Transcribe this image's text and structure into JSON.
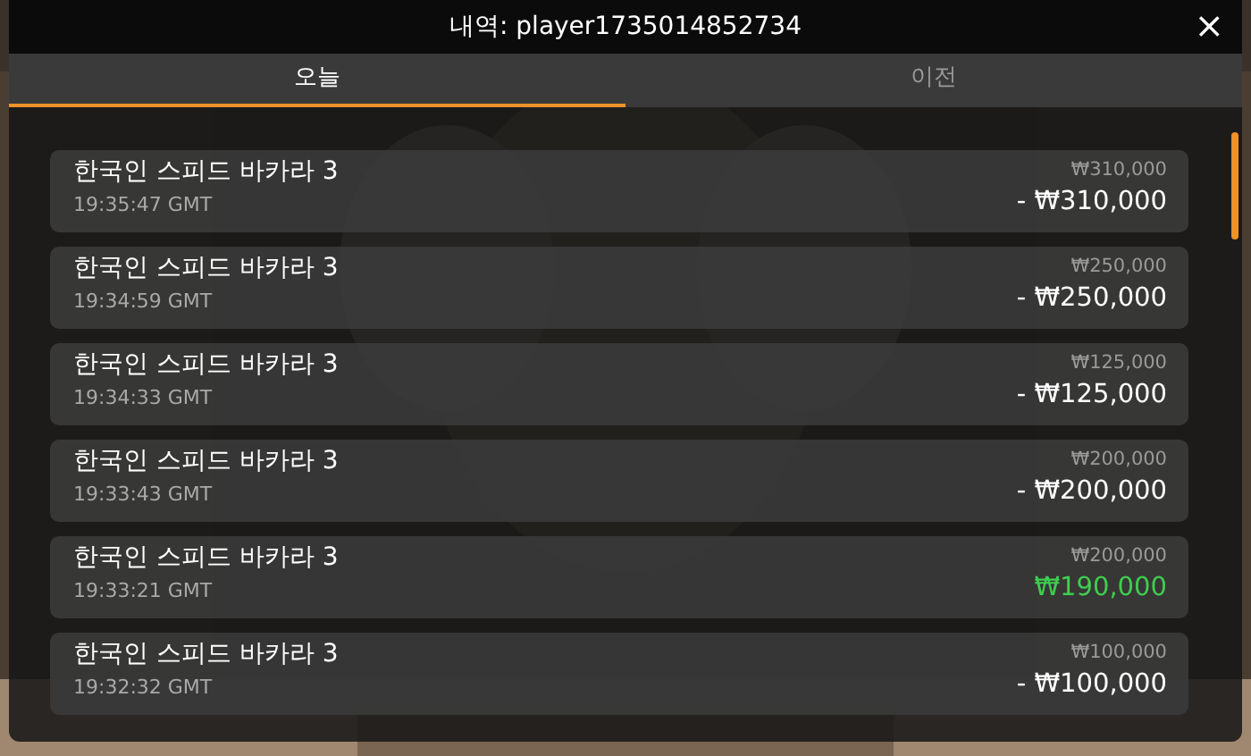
{
  "window": {
    "title": "내역: player1735014852734",
    "close": "×"
  },
  "tabs": [
    {
      "label": "오늘",
      "selected": true
    },
    {
      "label": "이전",
      "selected": false
    }
  ],
  "rows": [
    {
      "game": "한국인 스피드 바카라 3",
      "time": "19:35:47 GMT",
      "stake": "₩310,000",
      "result": "- ₩310,000",
      "win": false
    },
    {
      "game": "한국인 스피드 바카라 3",
      "time": "19:34:59 GMT",
      "stake": "₩250,000",
      "result": "- ₩250,000",
      "win": false
    },
    {
      "game": "한국인 스피드 바카라 3",
      "time": "19:34:33 GMT",
      "stake": "₩125,000",
      "result": "- ₩125,000",
      "win": false
    },
    {
      "game": "한국인 스피드 바카라 3",
      "time": "19:33:43 GMT",
      "stake": "₩200,000",
      "result": "- ₩200,000",
      "win": false
    },
    {
      "game": "한국인 스피드 바카라 3",
      "time": "19:33:21 GMT",
      "stake": "₩200,000",
      "result": "₩190,000",
      "win": true
    },
    {
      "game": "한국인 스피드 바카라 3",
      "time": "19:32:32 GMT",
      "stake": "₩100,000",
      "result": "- ₩100,000",
      "win": false
    }
  ]
}
